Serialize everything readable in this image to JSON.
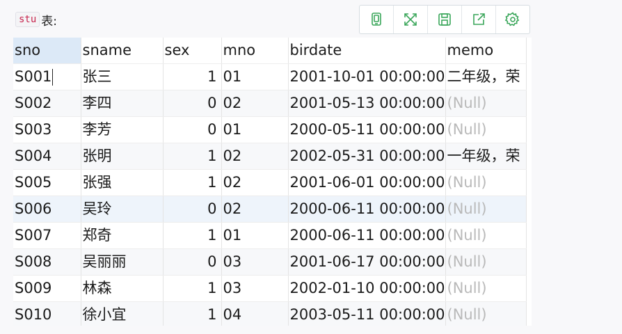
{
  "heading": {
    "code": "stu",
    "text": "表:"
  },
  "toolbar": {
    "buttons": [
      {
        "icon": "copy-icon",
        "color": "#3aa65a"
      },
      {
        "icon": "expand-icon",
        "color": "#3aa65a"
      },
      {
        "icon": "save-icon",
        "color": "#3aa65a"
      },
      {
        "icon": "share-icon",
        "color": "#3aa65a"
      },
      {
        "icon": "gear-icon",
        "color": "#3aa65a"
      }
    ]
  },
  "table": {
    "columns": [
      "sno",
      "sname",
      "sex",
      "mno",
      "birdate",
      "memo"
    ],
    "rows": [
      {
        "sno": "S001",
        "sname": "张三",
        "sex": "1",
        "mno": "01",
        "birdate": "2001-10-01 00:00:00",
        "memo": "二年级，荣"
      },
      {
        "sno": "S002",
        "sname": "李四",
        "sex": "0",
        "mno": "02",
        "birdate": "2001-05-13 00:00:00",
        "memo": "(Null)"
      },
      {
        "sno": "S003",
        "sname": "李芳",
        "sex": "0",
        "mno": "01",
        "birdate": "2000-05-11 00:00:00",
        "memo": "(Null)"
      },
      {
        "sno": "S004",
        "sname": "张明",
        "sex": "1",
        "mno": "02",
        "birdate": "2002-05-31 00:00:00",
        "memo": "一年级，荣"
      },
      {
        "sno": "S005",
        "sname": "张强",
        "sex": "1",
        "mno": "02",
        "birdate": "2001-06-01 00:00:00",
        "memo": "(Null)"
      },
      {
        "sno": "S006",
        "sname": "吴玲",
        "sex": "0",
        "mno": "02",
        "birdate": "2000-06-11 00:00:00",
        "memo": "(Null)"
      },
      {
        "sno": "S007",
        "sname": "郑奇",
        "sex": "1",
        "mno": "01",
        "birdate": "2000-06-11 00:00:00",
        "memo": "(Null)"
      },
      {
        "sno": "S008",
        "sname": "吴丽丽",
        "sex": "0",
        "mno": "03",
        "birdate": "2001-06-17 00:00:00",
        "memo": "(Null)"
      },
      {
        "sno": "S009",
        "sname": "林森",
        "sex": "1",
        "mno": "03",
        "birdate": "2002-01-10 00:00:00",
        "memo": "(Null)"
      },
      {
        "sno": "S010",
        "sname": "徐小宜",
        "sex": "1",
        "mno": "04",
        "birdate": "2003-05-11 00:00:00",
        "memo": "(Null)"
      }
    ]
  },
  "colors": {
    "header_selected": "#dce9f7",
    "null_text": "#b9b9b9",
    "code_text": "#c7254e"
  }
}
